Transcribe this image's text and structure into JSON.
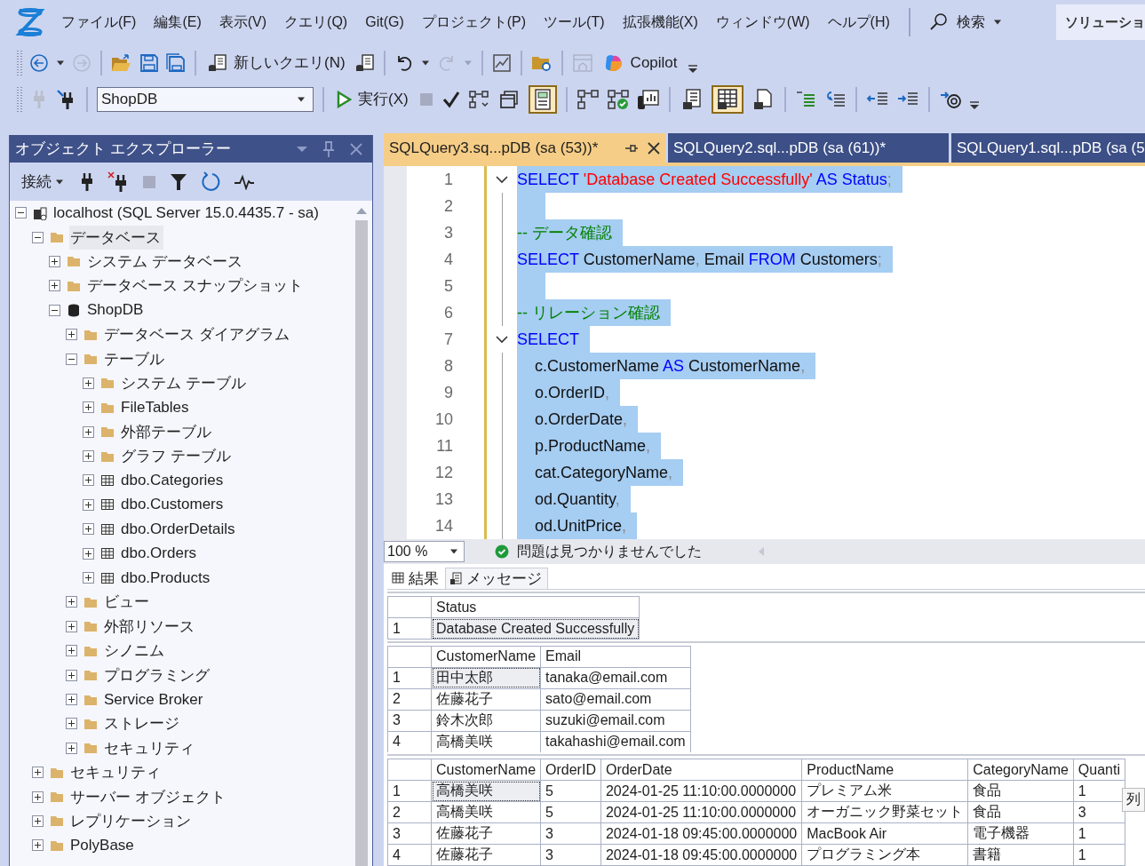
{
  "menu": [
    "ファイル(F)",
    "編集(E)",
    "表示(V)",
    "クエリ(Q)",
    "Git(G)",
    "プロジェクト(P)",
    "ツール(T)",
    "拡張機能(X)",
    "ウィンドウ(W)",
    "ヘルプ(H)"
  ],
  "search": {
    "label": "検索"
  },
  "solution_explorer_tab": "ソリューショ",
  "toolbar_1": {
    "new_query": "新しいクエリ(N)",
    "copilot": "Copilot"
  },
  "toolbar_2": {
    "database": "ShopDB",
    "execute": "実行(X)",
    "query_toggles": [
      {
        "selected": false
      },
      {
        "selected": true
      }
    ],
    "result_modes": [
      {
        "selected": false
      },
      {
        "selected": true
      },
      {
        "selected": false
      }
    ]
  },
  "object_explorer": {
    "title": "オブジェクト エクスプローラー",
    "connect": "接続",
    "tree": [
      {
        "label": "localhost (SQL Server 15.0.4435.7 - sa)",
        "kind": "server",
        "expanded": true,
        "selected": false,
        "children": [
          {
            "label": "データベース",
            "kind": "folder",
            "expanded": true,
            "selected": true,
            "children": [
              {
                "label": "システム データベース",
                "kind": "folder",
                "expanded": false,
                "selected": false
              },
              {
                "label": "データベース スナップショット",
                "kind": "folder",
                "expanded": false,
                "selected": false
              },
              {
                "label": "ShopDB",
                "kind": "database",
                "expanded": true,
                "selected": false,
                "children": [
                  {
                    "label": "データベース ダイアグラム",
                    "kind": "folder",
                    "expanded": false,
                    "selected": false
                  },
                  {
                    "label": "テーブル",
                    "kind": "folder",
                    "expanded": true,
                    "selected": false,
                    "children": [
                      {
                        "label": "システム テーブル",
                        "kind": "folder",
                        "expanded": false,
                        "selected": false
                      },
                      {
                        "label": "FileTables",
                        "kind": "folder",
                        "expanded": false,
                        "selected": false
                      },
                      {
                        "label": "外部テーブル",
                        "kind": "folder",
                        "expanded": false,
                        "selected": false
                      },
                      {
                        "label": "グラフ テーブル",
                        "kind": "folder",
                        "expanded": false,
                        "selected": false
                      },
                      {
                        "label": "dbo.Categories",
                        "kind": "table",
                        "expanded": false,
                        "selected": false
                      },
                      {
                        "label": "dbo.Customers",
                        "kind": "table",
                        "expanded": false,
                        "selected": false
                      },
                      {
                        "label": "dbo.OrderDetails",
                        "kind": "table",
                        "expanded": false,
                        "selected": false
                      },
                      {
                        "label": "dbo.Orders",
                        "kind": "table",
                        "expanded": false,
                        "selected": false
                      },
                      {
                        "label": "dbo.Products",
                        "kind": "table",
                        "expanded": false,
                        "selected": false
                      }
                    ]
                  },
                  {
                    "label": "ビュー",
                    "kind": "folder",
                    "expanded": false,
                    "selected": false
                  },
                  {
                    "label": "外部リソース",
                    "kind": "folder",
                    "expanded": false,
                    "selected": false
                  },
                  {
                    "label": "シノニム",
                    "kind": "folder",
                    "expanded": false,
                    "selected": false
                  },
                  {
                    "label": "プログラミング",
                    "kind": "folder",
                    "expanded": false,
                    "selected": false
                  },
                  {
                    "label": "Service Broker",
                    "kind": "folder",
                    "expanded": false,
                    "selected": false
                  },
                  {
                    "label": "ストレージ",
                    "kind": "folder",
                    "expanded": false,
                    "selected": false
                  },
                  {
                    "label": "セキュリティ",
                    "kind": "folder",
                    "expanded": false,
                    "selected": false
                  }
                ]
              }
            ]
          },
          {
            "label": "セキュリティ",
            "kind": "folder",
            "expanded": false,
            "selected": false
          },
          {
            "label": "サーバー オブジェクト",
            "kind": "folder",
            "expanded": false,
            "selected": false
          },
          {
            "label": "レプリケーション",
            "kind": "folder",
            "expanded": false,
            "selected": false
          },
          {
            "label": "PolyBase",
            "kind": "folder",
            "expanded": false,
            "selected": false
          }
        ]
      }
    ]
  },
  "editor_tabs": [
    {
      "label": "SQLQuery3.sq...pDB (sa (53))*",
      "selected": true
    },
    {
      "label": "SQLQuery2.sql...pDB (sa (61))*",
      "selected": false
    },
    {
      "label": "SQLQuery1.sql...pDB (sa (5",
      "selected": false
    }
  ],
  "editor": {
    "lines": [
      {
        "number": "1",
        "foldable": true,
        "selected": true,
        "tokens": [
          {
            "kind": "keyword",
            "text": "SELECT "
          },
          {
            "kind": "string",
            "text": "'Database Created Successfully' "
          },
          {
            "kind": "keyword",
            "text": "AS Status"
          },
          {
            "kind": "punct",
            "text": ";"
          }
        ]
      },
      {
        "number": "2",
        "foldable": false,
        "selected": true
      },
      {
        "number": "3",
        "foldable": false,
        "selected": true,
        "tokens": [
          {
            "kind": "comment",
            "text": "-- データ確認"
          }
        ]
      },
      {
        "number": "4",
        "foldable": false,
        "selected": true,
        "tokens": [
          {
            "kind": "keyword",
            "text": "SELECT"
          },
          {
            "kind": "plain",
            "text": " CustomerName"
          },
          {
            "kind": "punct",
            "text": ","
          },
          {
            "kind": "plain",
            "text": " Email "
          },
          {
            "kind": "keyword",
            "text": "FROM"
          },
          {
            "kind": "plain",
            "text": " Customers"
          },
          {
            "kind": "punct",
            "text": ";"
          }
        ]
      },
      {
        "number": "5",
        "foldable": false,
        "selected": true
      },
      {
        "number": "6",
        "foldable": false,
        "selected": true,
        "tokens": [
          {
            "kind": "comment",
            "text": "-- リレーション確認"
          }
        ]
      },
      {
        "number": "7",
        "foldable": true,
        "selected": true,
        "tokens": [
          {
            "kind": "keyword",
            "text": "SELECT"
          }
        ]
      },
      {
        "number": "8",
        "foldable": false,
        "selected": true,
        "tokens": [
          {
            "kind": "plain",
            "text": "    c.CustomerName "
          },
          {
            "kind": "keyword",
            "text": "AS"
          },
          {
            "kind": "plain",
            "text": " CustomerName"
          },
          {
            "kind": "punct",
            "text": ","
          }
        ]
      },
      {
        "number": "9",
        "foldable": false,
        "selected": true,
        "tokens": [
          {
            "kind": "plain",
            "text": "    o.OrderID"
          },
          {
            "kind": "punct",
            "text": ","
          }
        ]
      },
      {
        "number": "10",
        "foldable": false,
        "selected": true,
        "tokens": [
          {
            "kind": "plain",
            "text": "    o.OrderDate"
          },
          {
            "kind": "punct",
            "text": ","
          }
        ]
      },
      {
        "number": "11",
        "foldable": false,
        "selected": true,
        "tokens": [
          {
            "kind": "plain",
            "text": "    p.ProductName"
          },
          {
            "kind": "punct",
            "text": ","
          }
        ]
      },
      {
        "number": "12",
        "foldable": false,
        "selected": true,
        "tokens": [
          {
            "kind": "plain",
            "text": "    cat.CategoryName"
          },
          {
            "kind": "punct",
            "text": ","
          }
        ]
      },
      {
        "number": "13",
        "foldable": false,
        "selected": true,
        "tokens": [
          {
            "kind": "plain",
            "text": "    od.Quantity"
          },
          {
            "kind": "punct",
            "text": ","
          }
        ]
      },
      {
        "number": "14",
        "foldable": false,
        "selected": true,
        "tokens": [
          {
            "kind": "plain",
            "text": "    od.UnitPrice"
          },
          {
            "kind": "punct",
            "text": ","
          }
        ]
      }
    ]
  },
  "editor_status": {
    "zoom": "100 %",
    "message": "問題は見つかりませんでした"
  },
  "result_tabs": [
    {
      "label": "結果",
      "selected": true
    },
    {
      "label": "メッセージ",
      "selected": false
    }
  ],
  "result_grids": [
    {
      "columns": [
        "Status"
      ],
      "rows": [
        {
          "number": "1",
          "cells": [
            {
              "text": "Database Created Successfully",
              "selected": true
            }
          ]
        }
      ]
    },
    {
      "columns": [
        "CustomerName",
        "Email"
      ],
      "rows": [
        {
          "number": "1",
          "cells": [
            {
              "text": "田中太郎",
              "selected": true
            },
            {
              "text": "tanaka@email.com",
              "selected": false
            }
          ]
        },
        {
          "number": "2",
          "cells": [
            {
              "text": "佐藤花子",
              "selected": false
            },
            {
              "text": "sato@email.com",
              "selected": false
            }
          ]
        },
        {
          "number": "3",
          "cells": [
            {
              "text": "鈴木次郎",
              "selected": false
            },
            {
              "text": "suzuki@email.com",
              "selected": false
            }
          ]
        },
        {
          "number": "4",
          "cells": [
            {
              "text": "高橋美咲",
              "selected": false
            },
            {
              "text": "takahashi@email.com",
              "selected": false
            }
          ]
        }
      ]
    },
    {
      "columns": [
        "CustomerName",
        "OrderID",
        "OrderDate",
        "ProductName",
        "CategoryName",
        "Quanti"
      ],
      "rows": [
        {
          "number": "1",
          "cells": [
            {
              "text": "高橋美咲",
              "selected": true
            },
            {
              "text": "5",
              "selected": false
            },
            {
              "text": "2024-01-25 11:10:00.0000000",
              "selected": false
            },
            {
              "text": "プレミアム米",
              "selected": false
            },
            {
              "text": "食品",
              "selected": false
            },
            {
              "text": "1",
              "selected": false
            }
          ]
        },
        {
          "number": "2",
          "cells": [
            {
              "text": "高橋美咲",
              "selected": false
            },
            {
              "text": "5",
              "selected": false
            },
            {
              "text": "2024-01-25 11:10:00.0000000",
              "selected": false
            },
            {
              "text": "オーガニック野菜セット",
              "selected": false
            },
            {
              "text": "食品",
              "selected": false
            },
            {
              "text": "3",
              "selected": false
            }
          ]
        },
        {
          "number": "3",
          "cells": [
            {
              "text": "佐藤花子",
              "selected": false
            },
            {
              "text": "3",
              "selected": false
            },
            {
              "text": "2024-01-18 09:45:00.0000000",
              "selected": false
            },
            {
              "text": "MacBook Air",
              "selected": false
            },
            {
              "text": "電子機器",
              "selected": false
            },
            {
              "text": "1",
              "selected": false
            }
          ]
        },
        {
          "number": "4",
          "cells": [
            {
              "text": "佐藤花子",
              "selected": false
            },
            {
              "text": "3",
              "selected": false
            },
            {
              "text": "2024-01-18 09:45:00.0000000",
              "selected": false
            },
            {
              "text": "プログラミング本",
              "selected": false
            },
            {
              "text": "書籍",
              "selected": false
            },
            {
              "text": "1",
              "selected": false
            }
          ]
        }
      ]
    }
  ],
  "tooltip": "列"
}
